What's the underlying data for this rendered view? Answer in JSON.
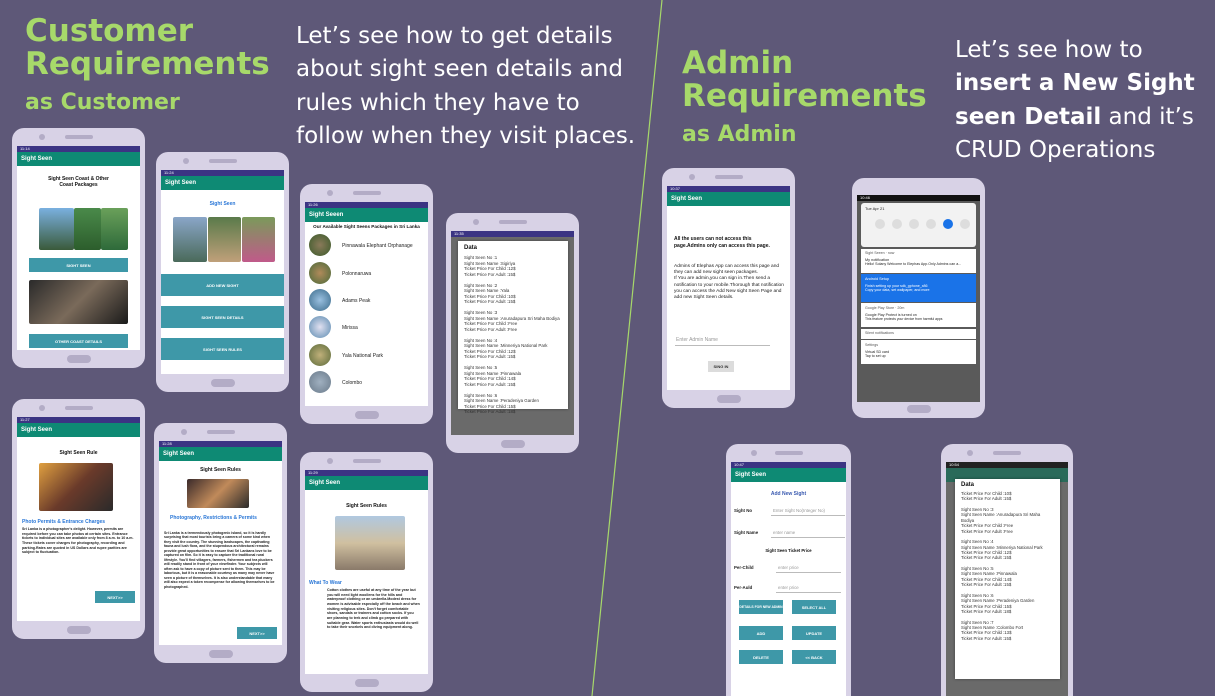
{
  "left": {
    "heading_line1": "Customer",
    "heading_line2": "Requirements",
    "heading_sub": "as Customer",
    "intro": "Let’s see how to get details about sight seen details and rules which they have to follow when they visit places."
  },
  "right": {
    "heading_line1": "Admin",
    "heading_line2": "Requirements",
    "heading_sub": "as Admin",
    "intro_pre": "Let’s see how to ",
    "intro_bold": "insert a New Sight seen Detail",
    "intro_post": " and it’s CRUD Operations"
  },
  "colors": {
    "background": "#5e5878",
    "heading": "#a7d96a",
    "appbar": "#0e8a74",
    "button": "#3e98a8"
  },
  "phones": {
    "p1": {
      "status": "11:14",
      "title": "Sight Seen",
      "heading": "Sight Seen Coast & Other\nCoast Packages",
      "btn1": "SIGHT SEEN",
      "btn2": "OTHER COAST DETAILS"
    },
    "p2": {
      "status": "11:24",
      "title": "Sight Seen",
      "subtitle": "Sight Seen",
      "btn1": "ADD NEW SIGHT",
      "btn2": "SIGHT SEEN DETAILS",
      "btn3": "SIGHT SEEN RULES"
    },
    "p3": {
      "status": "11:26",
      "title": "Sight Seeen",
      "heading": "Our Available Sight Seens Packages in Sri Lanka",
      "items": [
        "Pinnawala Elephant Orphanage",
        "Polonnaruwa",
        "Adams Peak",
        "Mirissa",
        "Yala National Park",
        "Colombo"
      ]
    },
    "p4": {
      "status": "11:35",
      "title": "Data",
      "text": "Sight Seen No :1\nSight Seen Name :Sigiriya\nTicket Price For Child :12$\nTicket Price For Adult :15$\n\nSight Seen No :2\nSight Seen Name :Yala\nTicket Price For Child :10$\nTicket Price For Adult :15$\n\nSight Seen No :3\nSight Seen Name :Anuradapura Sri Maha Bodiya\nTicket Price For Child :Free\nTicket Price For Adult :Free\n\nSight Seen No :4\nSight Seen Name :Minneriya National Park\nTicket Price For Child :12$\nTicket Price For Adult :15$\n\nSight Seen No :5\nSight Seen Name :Pinnawala\nTicket Price For Child :14$\nTicket Price For Adult :15$\n\nSight Seen No :6\nSight Seen Name :Peradeniya Garden\nTicket Price For Child :15$\nTicket Price For Adult :18$"
    },
    "p5": {
      "status": "11:27",
      "title": "Sight Seen",
      "heading": "Sight Seen Rule",
      "sub": "Photo Permits & Entrance Charges",
      "body": "Sri Lanka is a photographer's delight. However, permits are required before you can take photos at certain sites. Entrance tickets to individual sites are available only from 8 a.m. to 10 a.m. These tickets cover charges for photography, recording and parking.Rates are quoted in US Dollars and rupee parities are subject to fluctuation.",
      "btn": "NEXT>>"
    },
    "p6": {
      "status": "11:28",
      "title": "Sight Seen",
      "heading": "Sight Seen Rules",
      "sub": "Photography, Restrictions & Permits",
      "body": "Sri Lanka is a tremendously photogenic island, so it is hardly surprising that most tourists bring a camera of some kind when they visit the country. The stunning landscapes, the captivating fauna and lush flora, and the stupendous architectural remains provide great opportunities to ensure that Sri Lankans love to be captured on film. So it is easy to capture the traditional rural lifestyle. You'll find villagers, farmers, fishermen and tea pluckers will readily stand in front of your viewfinder. Your subjects will often ask to have a copy of picture sent to them. This may be laborious, but it is a reasonable courtesy as many may never have seen a picture of themselves. It is also understandable that many will also expect a token recompense for allowing themselves to be photographed.",
      "btn": "NEXT>>"
    },
    "p7": {
      "status": "11:29",
      "title": "Sight Seen",
      "heading": "Sight Seen Rules",
      "sub": "What To Wear",
      "body": "Cotton clothes are useful at any time of the year but you will need light woollens for the hills and waterproof clothing or an umbrella.Modest dress for women is advisable especially off the beach and when visiting religious sites. Don't forget comfortable shoes, sandals or trainers and cotton socks. If you are planning to trek and climb go prepared with suitable gear. Water sports enthusiasts would do well to take their snorkels and diving equipment along."
    },
    "p8": {
      "status": "10:37",
      "title": "Sight Seen",
      "warn": "All the users can not access this page.Admins only can access this page.",
      "body": "Admins of Elephas App can access this page and they can add new sight seen packages.\nIf You are admin,you can sign in.Then send a notification to your mobile.Thorough that notification you can access the Add New sight Seen Page and add new Sight Seen details.",
      "placeholder": "Enter Admin Name",
      "btn": "SING IN"
    },
    "p9": {
      "status": "10:46",
      "date": "Tue Apr 21",
      "notif_app": "Sight Seeen · now",
      "notif_title": "My notification",
      "notif_text": "Hello! Solany Welcome to Elephas App.Only Admins can a...",
      "setup_title": "Android Setup",
      "setup_text1": "Finish setting up your sdk_gphone_x86",
      "setup_text2": "Copy your data, set wallpaper, and more",
      "gp_title": "Google Play Store · 20m",
      "gp_text1": "Google Play Protect is turned on",
      "gp_text2": "This feature protects your device from harmful apps",
      "silent": "Silent notifications",
      "settings": "Settings",
      "sd1": "Virtual SD card",
      "sd2": "Tap to set up"
    },
    "p10": {
      "status": "10:47",
      "title": "Sight Seen",
      "heading": "Add New Sight",
      "l1": "Sight No",
      "ph1": "Enter Sight No(Integer No)",
      "l2": "Sight Name",
      "ph2": "enter name",
      "section": "Sight Seen Ticket Price",
      "l3": "Per-Child",
      "ph3": "enter price",
      "l4": "Per-Auld",
      "ph4": "enter price",
      "b1": "DETAILS FOR NEW ADMIN",
      "b2": "SELECT ALL",
      "b3": "ADD",
      "b4": "UPDATE",
      "b5": "DELETE",
      "b6": "<< BACK"
    },
    "p11": {
      "status": "10:54",
      "title": "Data",
      "text": "Ticket Price For Child :10$\nTicket Price For Adult :15$\n\nSight Seen No :3\nSight Seen Name :Anuradapura Sri Maha Bodiya\nTicket Price For Child :Free\nTicket Price For Adult :Free\n\nSight Seen No :4\nSight Seen Name :Minneriya National Park\nTicket Price For Child :12$\nTicket Price For Adult :15$\n\nSight Seen No :5\nSight Seen Name :Pinnawala\nTicket Price For Child :14$\nTicket Price For Adult :15$\n\nSight Seen No :6\nSight Seen Name :Peradeniya Garden\nTicket Price For Child :15$\nTicket Price For Adult :18$\n\nSight Seen No :7\nSight Seen Name :Colombo Fort\nTicket Price For Child :13$\nTicket Price For Adult :15$"
    }
  }
}
